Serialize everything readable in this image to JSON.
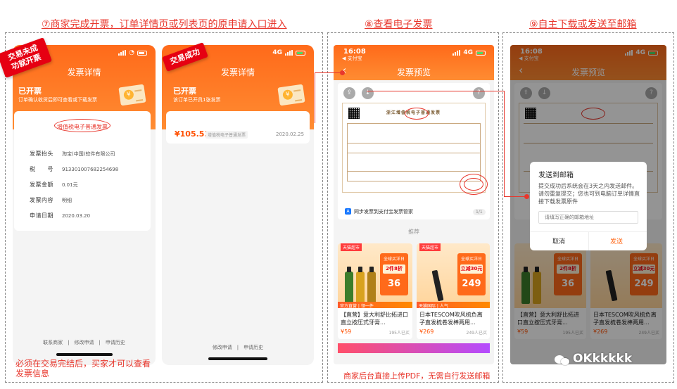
{
  "sections": {
    "s7_title": "⑦商家完成开票，订单详情页或列表页的原申请入口进入",
    "s8_title": "⑧查看电子发票",
    "s9_title": "⑨自主下载或发送至邮箱"
  },
  "phone1": {
    "ribbon": "交易未成功就开票",
    "page_title": "发票详情",
    "issued_title": "已开票",
    "issued_sub": "订单确认收货后即可查看或下载发票",
    "card_title": "增值税电子普通发票",
    "rows": [
      {
        "label": "发票抬头",
        "value": "淘宝(中国)软件有限公司"
      },
      {
        "label": "税　　号",
        "value": "913301007682254698"
      },
      {
        "label": "发票金额",
        "value": "0.01元"
      },
      {
        "label": "发票内容",
        "value": "明细"
      },
      {
        "label": "申请日期",
        "value": "2020.03.20"
      }
    ],
    "footer": "联系商家　|　修改申请　|　申请历史",
    "note": "必须在交易完结后，买家才可以查看发票信息"
  },
  "phone2": {
    "ribbon": "交易成功",
    "page_title": "发票详情",
    "issued_title": "已开票",
    "issued_sub": "该订单已开具1张发票",
    "amount": "¥105.53",
    "tag": "增值税电子普通发票",
    "date": "2020.02.25",
    "footer": "修改申请　|　申请历史"
  },
  "phone3": {
    "time": "16:08",
    "carrier": "◀ 支付宝",
    "network": "4G",
    "page_title": "发票预览",
    "invoice_header": "浙江增值税电子普通发票",
    "sync_text": "同步发票到支付宝发票管家",
    "page_indicator": "1/1",
    "rec_label": "推荐",
    "bottom_note": "商家后台直接上传PDF，无需自行发送邮箱",
    "products": [
      {
        "badge": "天猫超市",
        "tag_top": "全球买洋日",
        "tag_mid": "2件8折",
        "tag_price": "36",
        "strip": "官方直营 | 领一件",
        "name": "【直营】意大利舒比拓进口直立按压式牙膏...",
        "price": "¥59",
        "sold": "195人已买"
      },
      {
        "badge": "天猫超市",
        "tag_top": "全球买洋日",
        "tag_mid": "立减30元",
        "tag_price": "249",
        "strip": "天猫国际 | 人气",
        "name": "日本TESCOM吹风梳负离子直发梳卷发棒两用...",
        "price": "¥269",
        "sold": "249人已买"
      }
    ]
  },
  "phone4": {
    "time": "16:08",
    "carrier": "◀ 支付宝",
    "network": "4G",
    "page_title": "发票预览",
    "dialog": {
      "title": "发送到邮箱",
      "body": "提交成功后系统会在3天之内发送邮件。请勿重复提交；您也可到电脑订单详情直接下载发票原件",
      "placeholder": "请填写正确的邮箱地址",
      "cancel": "取消",
      "send": "发送"
    },
    "products": [
      {
        "name": "【直营】意大利舒比拓进口直立按压式牙膏...",
        "price": "¥59",
        "sold": "195人已买"
      },
      {
        "name": "日本TESCOM吹风梳负离子直发梳卷发棒两用...",
        "price": "¥269",
        "sold": "249人已买"
      }
    ]
  },
  "watermark": "OKkkkkk",
  "colors": {
    "accent": "#e8372d",
    "orange": "#ff6a1a",
    "link_blue": "#1677ff"
  }
}
